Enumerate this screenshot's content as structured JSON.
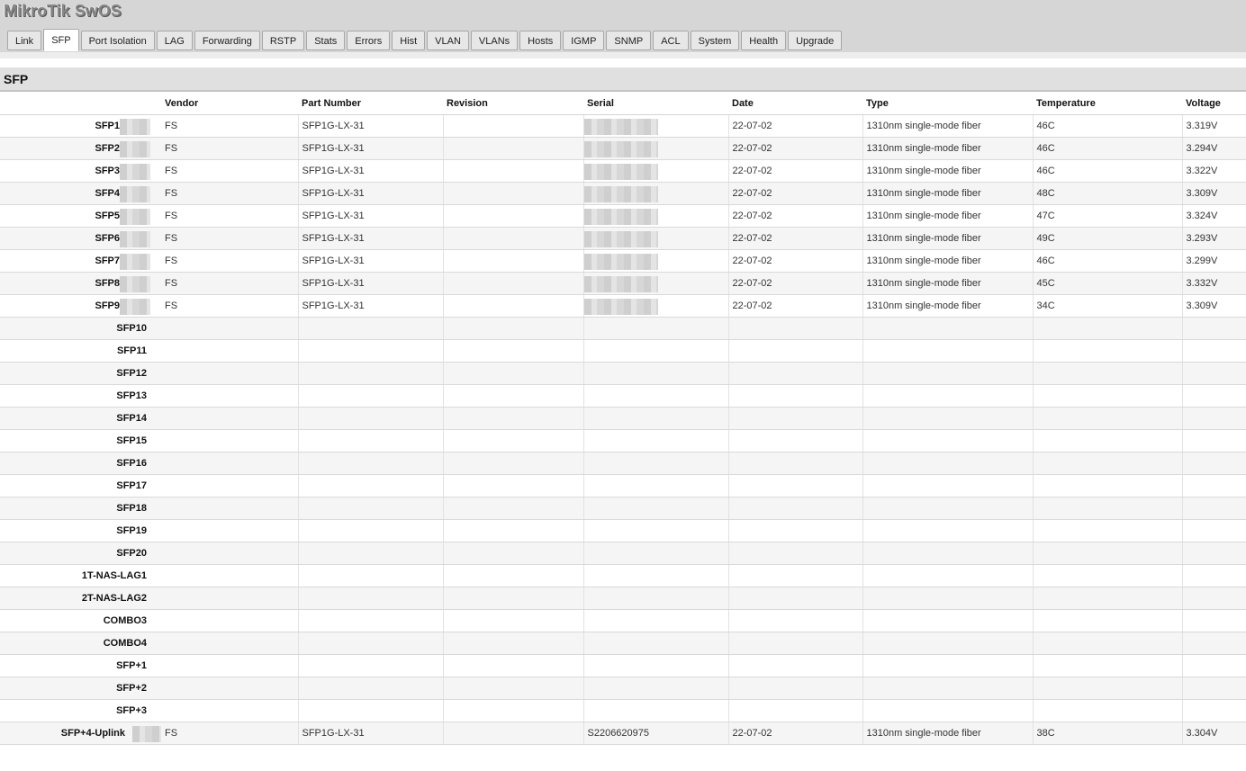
{
  "app_title": "MikroTik SwOS",
  "tabs": [
    {
      "label": "Link",
      "active": false
    },
    {
      "label": "SFP",
      "active": true
    },
    {
      "label": "Port Isolation",
      "active": false
    },
    {
      "label": "LAG",
      "active": false
    },
    {
      "label": "Forwarding",
      "active": false
    },
    {
      "label": "RSTP",
      "active": false
    },
    {
      "label": "Stats",
      "active": false
    },
    {
      "label": "Errors",
      "active": false
    },
    {
      "label": "Hist",
      "active": false
    },
    {
      "label": "VLAN",
      "active": false
    },
    {
      "label": "VLANs",
      "active": false
    },
    {
      "label": "Hosts",
      "active": false
    },
    {
      "label": "IGMP",
      "active": false
    },
    {
      "label": "SNMP",
      "active": false
    },
    {
      "label": "ACL",
      "active": false
    },
    {
      "label": "System",
      "active": false
    },
    {
      "label": "Health",
      "active": false
    },
    {
      "label": "Upgrade",
      "active": false
    }
  ],
  "section_title": "SFP",
  "columns": [
    "",
    "Vendor",
    "Part Number",
    "Revision",
    "Serial",
    "Date",
    "Type",
    "Temperature",
    "Voltage"
  ],
  "rows": [
    {
      "port": "SFP1",
      "vendor": "FS",
      "part": "SFP1G-LX-31",
      "revision": "",
      "serial": "",
      "date": "22-07-02",
      "type": "1310nm single-mode fiber",
      "temp": "46C",
      "voltage": "3.319V",
      "redacted": true
    },
    {
      "port": "SFP2",
      "vendor": "FS",
      "part": "SFP1G-LX-31",
      "revision": "",
      "serial": "",
      "date": "22-07-02",
      "type": "1310nm single-mode fiber",
      "temp": "46C",
      "voltage": "3.294V",
      "redacted": true
    },
    {
      "port": "SFP3",
      "vendor": "FS",
      "part": "SFP1G-LX-31",
      "revision": "",
      "serial": "",
      "date": "22-07-02",
      "type": "1310nm single-mode fiber",
      "temp": "46C",
      "voltage": "3.322V",
      "redacted": true
    },
    {
      "port": "SFP4",
      "vendor": "FS",
      "part": "SFP1G-LX-31",
      "revision": "",
      "serial": "",
      "date": "22-07-02",
      "type": "1310nm single-mode fiber",
      "temp": "48C",
      "voltage": "3.309V",
      "redacted": true
    },
    {
      "port": "SFP5",
      "vendor": "FS",
      "part": "SFP1G-LX-31",
      "revision": "",
      "serial": "",
      "date": "22-07-02",
      "type": "1310nm single-mode fiber",
      "temp": "47C",
      "voltage": "3.324V",
      "redacted": true
    },
    {
      "port": "SFP6",
      "vendor": "FS",
      "part": "SFP1G-LX-31",
      "revision": "",
      "serial": "",
      "date": "22-07-02",
      "type": "1310nm single-mode fiber",
      "temp": "49C",
      "voltage": "3.293V",
      "redacted": true
    },
    {
      "port": "SFP7",
      "vendor": "FS",
      "part": "SFP1G-LX-31",
      "revision": "",
      "serial": "",
      "date": "22-07-02",
      "type": "1310nm single-mode fiber",
      "temp": "46C",
      "voltage": "3.299V",
      "redacted": true
    },
    {
      "port": "SFP8",
      "vendor": "FS",
      "part": "SFP1G-LX-31",
      "revision": "",
      "serial": "",
      "date": "22-07-02",
      "type": "1310nm single-mode fiber",
      "temp": "45C",
      "voltage": "3.332V",
      "redacted": true
    },
    {
      "port": "SFP9",
      "vendor": "FS",
      "part": "SFP1G-LX-31",
      "revision": "",
      "serial": "",
      "date": "22-07-02",
      "type": "1310nm single-mode fiber",
      "temp": "34C",
      "voltage": "3.309V",
      "redacted": true
    },
    {
      "port": "SFP10",
      "vendor": "",
      "part": "",
      "revision": "",
      "serial": "",
      "date": "",
      "type": "",
      "temp": "",
      "voltage": "",
      "redacted": false
    },
    {
      "port": "SFP11",
      "vendor": "",
      "part": "",
      "revision": "",
      "serial": "",
      "date": "",
      "type": "",
      "temp": "",
      "voltage": "",
      "redacted": false
    },
    {
      "port": "SFP12",
      "vendor": "",
      "part": "",
      "revision": "",
      "serial": "",
      "date": "",
      "type": "",
      "temp": "",
      "voltage": "",
      "redacted": false
    },
    {
      "port": "SFP13",
      "vendor": "",
      "part": "",
      "revision": "",
      "serial": "",
      "date": "",
      "type": "",
      "temp": "",
      "voltage": "",
      "redacted": false
    },
    {
      "port": "SFP14",
      "vendor": "",
      "part": "",
      "revision": "",
      "serial": "",
      "date": "",
      "type": "",
      "temp": "",
      "voltage": "",
      "redacted": false
    },
    {
      "port": "SFP15",
      "vendor": "",
      "part": "",
      "revision": "",
      "serial": "",
      "date": "",
      "type": "",
      "temp": "",
      "voltage": "",
      "redacted": false
    },
    {
      "port": "SFP16",
      "vendor": "",
      "part": "",
      "revision": "",
      "serial": "",
      "date": "",
      "type": "",
      "temp": "",
      "voltage": "",
      "redacted": false
    },
    {
      "port": "SFP17",
      "vendor": "",
      "part": "",
      "revision": "",
      "serial": "",
      "date": "",
      "type": "",
      "temp": "",
      "voltage": "",
      "redacted": false
    },
    {
      "port": "SFP18",
      "vendor": "",
      "part": "",
      "revision": "",
      "serial": "",
      "date": "",
      "type": "",
      "temp": "",
      "voltage": "",
      "redacted": false
    },
    {
      "port": "SFP19",
      "vendor": "",
      "part": "",
      "revision": "",
      "serial": "",
      "date": "",
      "type": "",
      "temp": "",
      "voltage": "",
      "redacted": false
    },
    {
      "port": "SFP20",
      "vendor": "",
      "part": "",
      "revision": "",
      "serial": "",
      "date": "",
      "type": "",
      "temp": "",
      "voltage": "",
      "redacted": false
    },
    {
      "port": "1T-NAS-LAG1",
      "vendor": "",
      "part": "",
      "revision": "",
      "serial": "",
      "date": "",
      "type": "",
      "temp": "",
      "voltage": "",
      "redacted": false
    },
    {
      "port": "2T-NAS-LAG2",
      "vendor": "",
      "part": "",
      "revision": "",
      "serial": "",
      "date": "",
      "type": "",
      "temp": "",
      "voltage": "",
      "redacted": false
    },
    {
      "port": "COMBO3",
      "vendor": "",
      "part": "",
      "revision": "",
      "serial": "",
      "date": "",
      "type": "",
      "temp": "",
      "voltage": "",
      "redacted": false
    },
    {
      "port": "COMBO4",
      "vendor": "",
      "part": "",
      "revision": "",
      "serial": "",
      "date": "",
      "type": "",
      "temp": "",
      "voltage": "",
      "redacted": false
    },
    {
      "port": "SFP+1",
      "vendor": "",
      "part": "",
      "revision": "",
      "serial": "",
      "date": "",
      "type": "",
      "temp": "",
      "voltage": "",
      "redacted": false
    },
    {
      "port": "SFP+2",
      "vendor": "",
      "part": "",
      "revision": "",
      "serial": "",
      "date": "",
      "type": "",
      "temp": "",
      "voltage": "",
      "redacted": false
    },
    {
      "port": "SFP+3",
      "vendor": "",
      "part": "",
      "revision": "",
      "serial": "",
      "date": "",
      "type": "",
      "temp": "",
      "voltage": "",
      "redacted": false
    },
    {
      "port": "SFP+4-Uplink",
      "vendor": "FS",
      "part": "SFP1G-LX-31",
      "revision": "",
      "serial": "S2206620975",
      "date": "22-07-02",
      "type": "1310nm single-mode fiber",
      "temp": "38C",
      "voltage": "3.304V",
      "redacted": true
    }
  ]
}
